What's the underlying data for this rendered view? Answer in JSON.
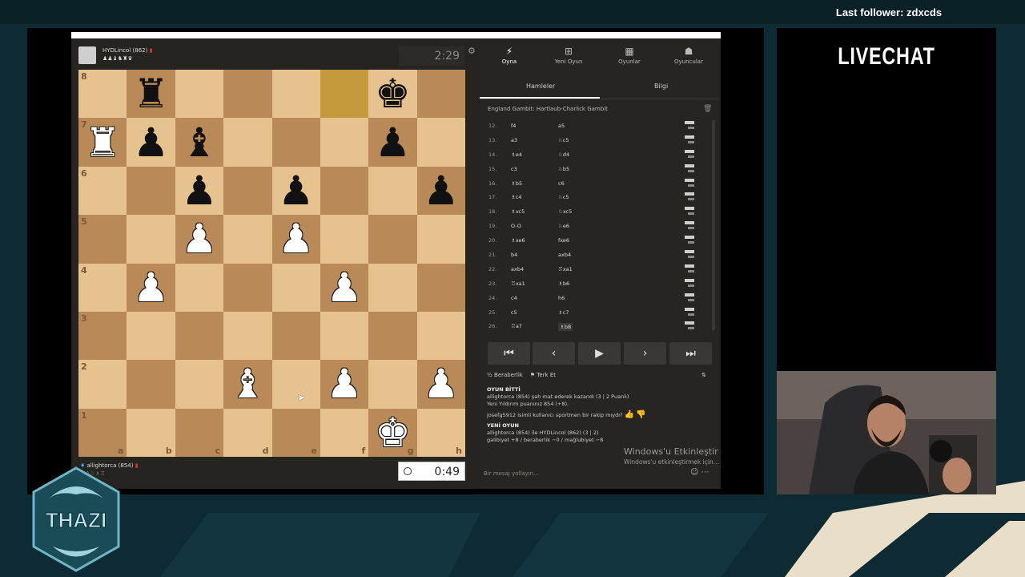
{
  "overlay": {
    "last_follower": "Last follower: zdxcds",
    "livechat_title": "LIVECHAT",
    "logo_text": "THAZI"
  },
  "top_player": {
    "name": "HYDLincol (862)",
    "clock": "2:29"
  },
  "bottom_player": {
    "name": "allightorca (854)",
    "clock": "0:49"
  },
  "board": {
    "ranks": [
      "8",
      "7",
      "6",
      "5",
      "4",
      "3",
      "2",
      "1"
    ],
    "files": [
      "a",
      "b",
      "c",
      "d",
      "e",
      "f",
      "g",
      "h"
    ],
    "pieces": [
      [
        "",
        "bR",
        "",
        "",
        "",
        "",
        "bK",
        ""
      ],
      [
        "wR",
        "bP",
        "bB",
        "",
        "",
        "",
        "bP",
        ""
      ],
      [
        "",
        "",
        "bP",
        "",
        "bP",
        "",
        "",
        "bP"
      ],
      [
        "",
        "",
        "wP",
        "",
        "wP",
        "",
        "",
        ""
      ],
      [
        "",
        "wP",
        "",
        "",
        "",
        "wP",
        "",
        ""
      ],
      [
        "",
        "",
        "",
        "",
        "",
        "",
        "",
        ""
      ],
      [
        "",
        "",
        "",
        "wB",
        "",
        "wP",
        "",
        "wP"
      ],
      [
        "",
        "",
        "",
        "",
        "",
        "",
        "wK",
        ""
      ]
    ],
    "highlight": "f8"
  },
  "tabs": [
    {
      "label": "Oyna",
      "icon": "lightning-icon"
    },
    {
      "label": "Yeni Oyun",
      "icon": "plus-icon"
    },
    {
      "label": "Oyunlar",
      "icon": "board-icon"
    },
    {
      "label": "Oyuncular",
      "icon": "people-icon"
    }
  ],
  "subtabs": {
    "moves": "Hamleler",
    "info": "Bilgi"
  },
  "opening": "England Gambit: Hartlaub-Charlick Gambit",
  "moves": [
    {
      "n": "12.",
      "w": "f4",
      "b": "a5"
    },
    {
      "n": "13.",
      "w": "a3",
      "b": "♘c5"
    },
    {
      "n": "14.",
      "w": "♗e4",
      "b": "♘d4"
    },
    {
      "n": "15.",
      "w": "c3",
      "b": "♘b5"
    },
    {
      "n": "16.",
      "w": "♗b5",
      "b": "c6"
    },
    {
      "n": "17.",
      "w": "♗c4",
      "b": "♘c5"
    },
    {
      "n": "18.",
      "w": "♗xc5",
      "b": "♘xc5"
    },
    {
      "n": "19.",
      "w": "O-O",
      "b": "♘e6"
    },
    {
      "n": "20.",
      "w": "♗xe6",
      "b": "fxe6"
    },
    {
      "n": "21.",
      "w": "b4",
      "b": "axb4"
    },
    {
      "n": "22.",
      "w": "axb4",
      "b": "♖xa1"
    },
    {
      "n": "23.",
      "w": "♖xa1",
      "b": "♗b6"
    },
    {
      "n": "24.",
      "w": "c4",
      "b": "h6"
    },
    {
      "n": "25.",
      "w": "c5",
      "b": "♗c7"
    },
    {
      "n": "26.",
      "w": "♖a7",
      "b": "♗b8"
    }
  ],
  "actions": {
    "draw": "Beraberlik",
    "resign": "Terk Et"
  },
  "chat": {
    "header1": "OYUN BİTTİ",
    "line1": "allightorca (854) şah mat ederek kazandı (3 | 2 Puanlı)",
    "line2": "Yeni Yıldırım puanınız 854 (+8).",
    "line3": "josefg5912 isimli kullanıcı sportmen bir rakip mıydı?",
    "header2": "YENİ OYUN",
    "line4": "allightorca (854) ile HYDLincol (862) (3 | 2)",
    "line5": "galibiyet +8 / beraberlik −0 / mağlubiyet −8",
    "placeholder": "Bir mesaj yollayın..."
  },
  "windows_notice": {
    "title": "Windows'u Etkinleştir",
    "sub": "Windows'u etkinleştirmek için..."
  }
}
